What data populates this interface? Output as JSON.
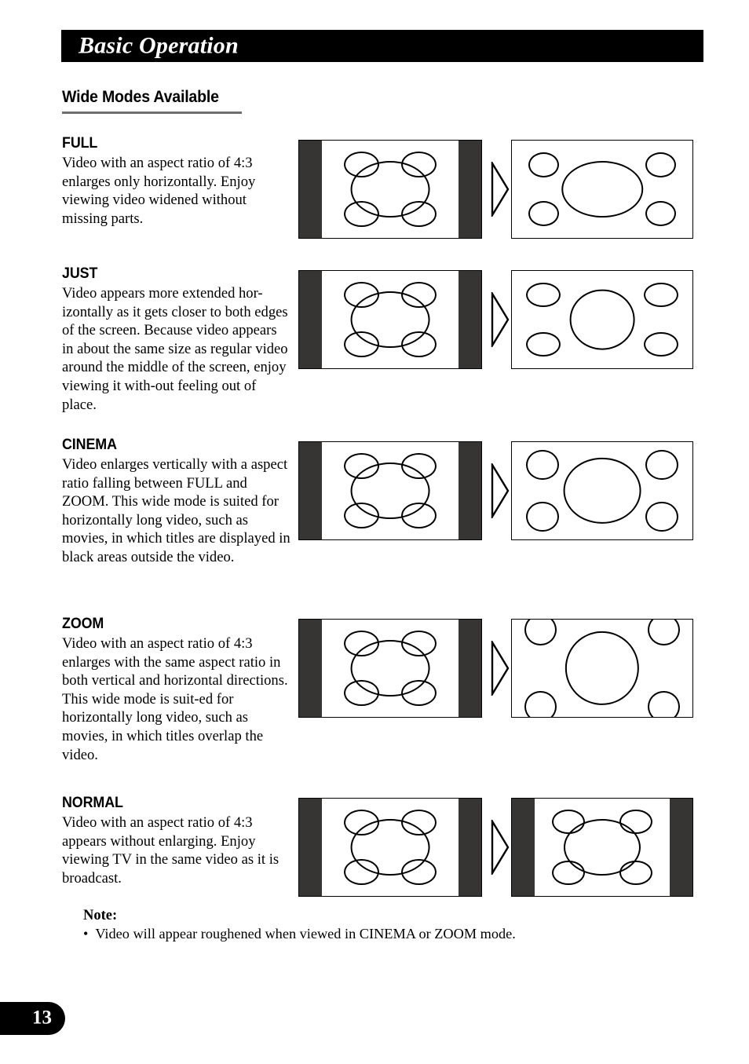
{
  "header": {
    "title": "Basic Operation"
  },
  "section": {
    "heading": "Wide Modes Available"
  },
  "modes": [
    {
      "title": "FULL",
      "body": "Video with an aspect ratio of 4:3 enlarges only horizontally. Enjoy viewing video widened without missing parts.",
      "arrow_icon": "right-triangle-outline-icon"
    },
    {
      "title": "JUST",
      "body": "Video appears more extended hor-izontally as it gets closer to both edges of the screen. Because video appears in about the same size as regular video around the middle of the screen, enjoy viewing it with-out feeling out of place.",
      "arrow_icon": "right-triangle-outline-icon"
    },
    {
      "title": "CINEMA",
      "body": "Video enlarges vertically with a aspect ratio falling between FULL and ZOOM. This wide mode is suited for horizontally long video, such as movies, in which titles are displayed in black areas outside the video.",
      "arrow_icon": "right-triangle-outline-icon"
    },
    {
      "title": "ZOOM",
      "body": "Video with an aspect ratio of 4:3 enlarges with the same aspect ratio in both vertical and horizontal directions. This wide mode is suit-ed for horizontally long video, such as movies, in which titles overlap the video.",
      "arrow_icon": "right-triangle-outline-icon"
    },
    {
      "title": "NORMAL",
      "body": "Video with an aspect ratio of 4:3 appears without enlarging. Enjoy viewing TV in the same video as it is broadcast.",
      "arrow_icon": "right-triangle-outline-icon"
    }
  ],
  "note": {
    "title": "Note:",
    "bullet": "•",
    "text": "Video will appear roughened when viewed in CINEMA or ZOOM mode."
  },
  "footer": {
    "page_number": "13"
  },
  "colors": {
    "header_bar": "#000000",
    "header_text": "#ffffff",
    "rule": "#6e6e6e",
    "letterbox_bar": "#373434",
    "outline": "#000000",
    "screen_fill": "#ffffff"
  },
  "diagram": {
    "source_label": "4:3 source video pillarboxed on wide screen",
    "result_labels": [
      "stretched horizontally to fill width",
      "stretched progressively more toward edges",
      "enlarged between FULL and ZOOM",
      "enlarged equally, cropped top and bottom",
      "unchanged, pillarbox bars kept"
    ]
  }
}
